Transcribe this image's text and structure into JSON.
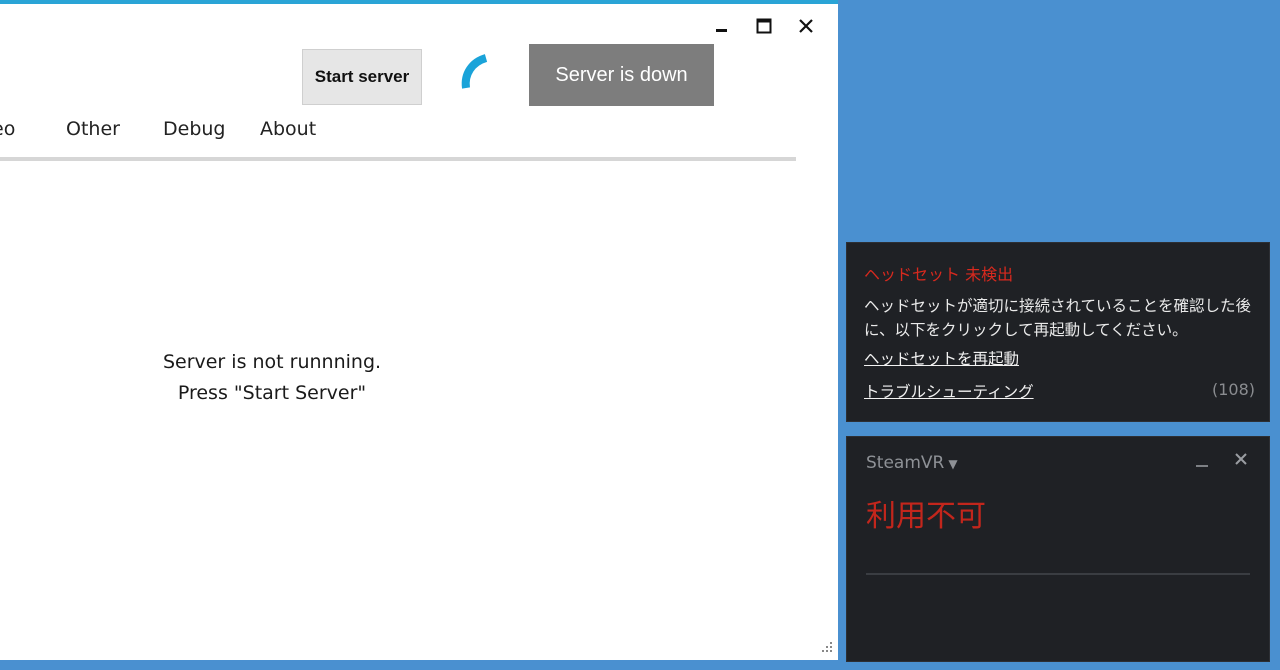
{
  "window": {
    "start_button_label": "Start server",
    "status_text": "Server is down",
    "tabs": [
      {
        "label": "eo"
      },
      {
        "label": "Other"
      },
      {
        "label": "Debug"
      },
      {
        "label": "About"
      }
    ],
    "message_line1": "Server is not runnning.",
    "message_line2": "Press \"Start Server\"",
    "colors": {
      "accent": "#2aa4d6",
      "status_bg": "#7d7d7d"
    }
  },
  "notification": {
    "title": "ヘッドセット 未検出",
    "body": "ヘッドセットが適切に接続されていることを確認した後に、以下をクリックして再起動してください。",
    "link_restart": "ヘッドセットを再起動",
    "link_troubleshoot": "トラブルシューティング",
    "count": "(108)",
    "colors": {
      "title": "#d8291e",
      "background": "#1f2125"
    }
  },
  "steamvr": {
    "title": "SteamVR",
    "status": "利用不可",
    "colors": {
      "status": "#c3261c"
    }
  },
  "desktop": {
    "background": "#4a90d0"
  }
}
